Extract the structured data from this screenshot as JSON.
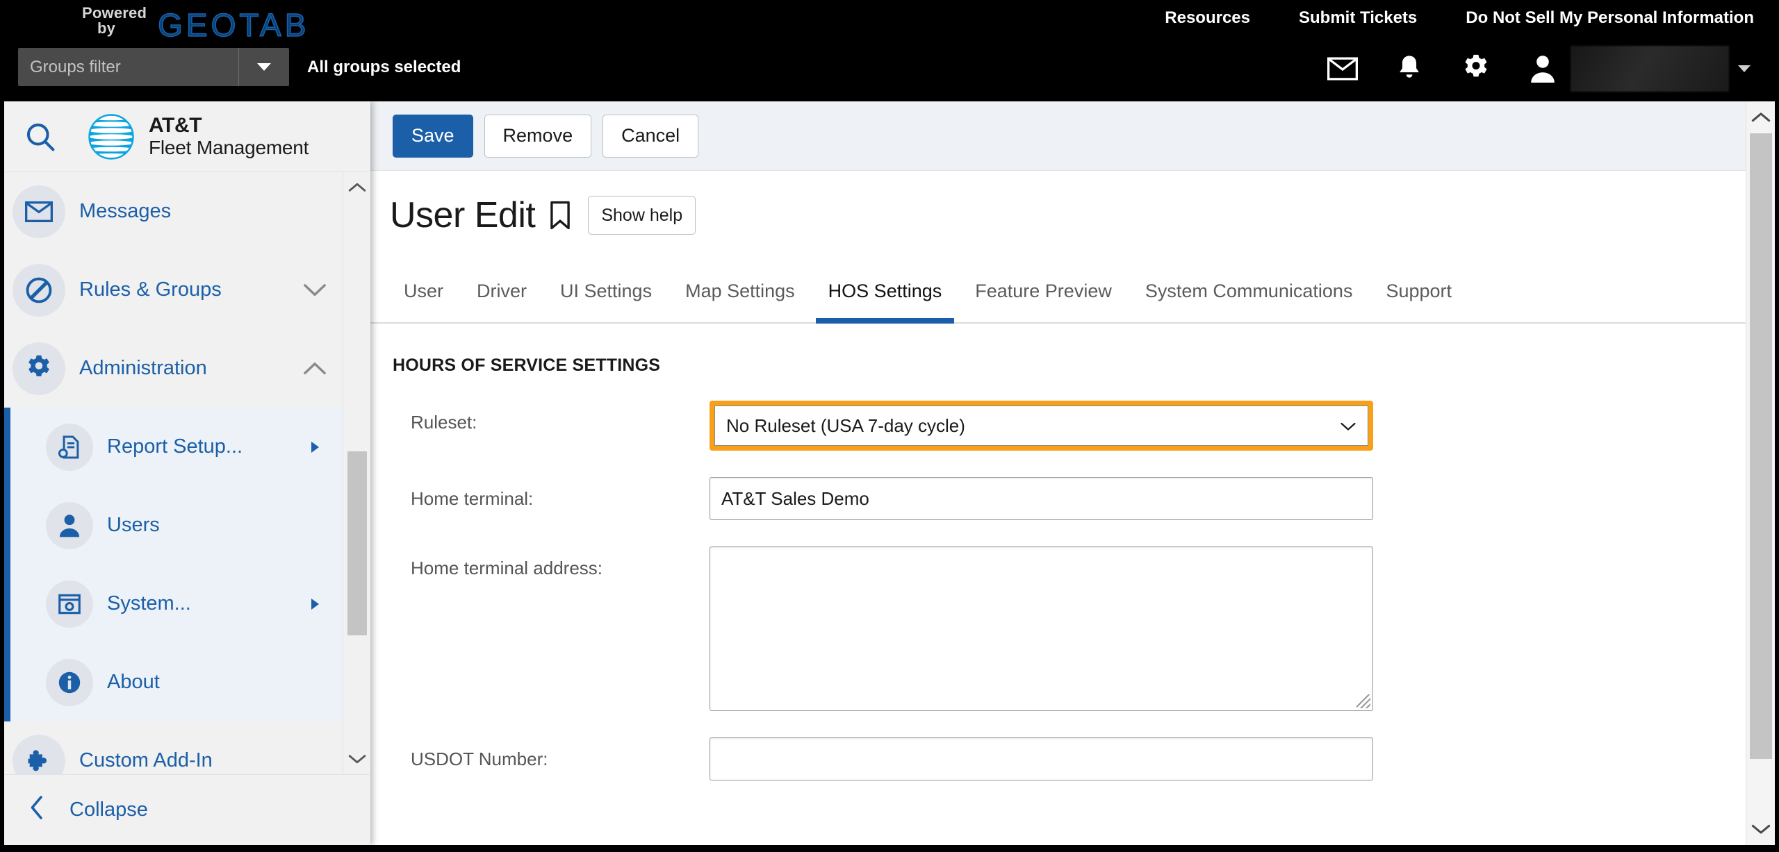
{
  "topbar": {
    "powered_line1": "Powered",
    "powered_line2": "by",
    "logo": "GEOTAB",
    "links": [
      {
        "label": "Resources",
        "name": "resources-link"
      },
      {
        "label": "Submit Tickets",
        "name": "submit-tickets-link"
      },
      {
        "label": "Do Not Sell My Personal Information",
        "name": "do-not-sell-link"
      }
    ],
    "groups_filter_placeholder": "Groups filter",
    "groups_filter_value": "",
    "all_groups_status": "All groups selected",
    "icons": {
      "mail": "mail-icon",
      "bell": "bell-icon",
      "gear": "gear-icon",
      "user": "user-icon"
    },
    "user_name": ""
  },
  "sidebar": {
    "search_placeholder": "",
    "brand_line1": "AT&T",
    "brand_line2": "Fleet Management",
    "items": [
      {
        "label": "Messages",
        "icon": "envelope-icon",
        "type": "top",
        "expander": "none"
      },
      {
        "label": "Rules & Groups",
        "icon": "no-entry-icon",
        "type": "top",
        "expander": "down"
      },
      {
        "label": "Administration",
        "icon": "gear-icon",
        "type": "top",
        "expander": "up"
      },
      {
        "label": "Report Setup...",
        "icon": "report-setup-icon",
        "type": "child",
        "expander": "right"
      },
      {
        "label": "Users",
        "icon": "person-icon",
        "type": "child",
        "expander": "none"
      },
      {
        "label": "System...",
        "icon": "system-icon",
        "type": "child",
        "expander": "right"
      },
      {
        "label": "About",
        "icon": "info-icon",
        "type": "child",
        "expander": "none"
      },
      {
        "label": "Custom Add-In",
        "icon": "puzzle-icon",
        "type": "top",
        "expander": "none"
      }
    ],
    "collapse_label": "Collapse"
  },
  "main": {
    "actions": [
      {
        "label": "Save",
        "name": "save-button",
        "style": "primary"
      },
      {
        "label": "Remove",
        "name": "remove-button",
        "style": "default"
      },
      {
        "label": "Cancel",
        "name": "cancel-button",
        "style": "default"
      }
    ],
    "page_title": "User Edit",
    "show_help_label": "Show help",
    "tabs": [
      {
        "label": "User",
        "active": false
      },
      {
        "label": "Driver",
        "active": false
      },
      {
        "label": "UI Settings",
        "active": false
      },
      {
        "label": "Map Settings",
        "active": false
      },
      {
        "label": "HOS Settings",
        "active": true
      },
      {
        "label": "Feature Preview",
        "active": false
      },
      {
        "label": "System Communications",
        "active": false
      },
      {
        "label": "Support",
        "active": false
      }
    ],
    "section_title": "HOURS OF SERVICE SETTINGS",
    "fields": {
      "ruleset_label": "Ruleset:",
      "ruleset_value": "No Ruleset (USA 7-day cycle)",
      "home_terminal_label": "Home terminal:",
      "home_terminal_value": "AT&T Sales Demo",
      "home_terminal_address_label": "Home terminal address:",
      "home_terminal_address_value": "",
      "usdot_label": "USDOT Number:",
      "usdot_value": ""
    }
  },
  "colors": {
    "accent_blue": "#1b5fa8",
    "highlight_orange": "#f9a01b",
    "topbar_black": "#000000",
    "sidebar_bg": "#f1f1f1",
    "actionbar_bg": "#eef1f5"
  }
}
